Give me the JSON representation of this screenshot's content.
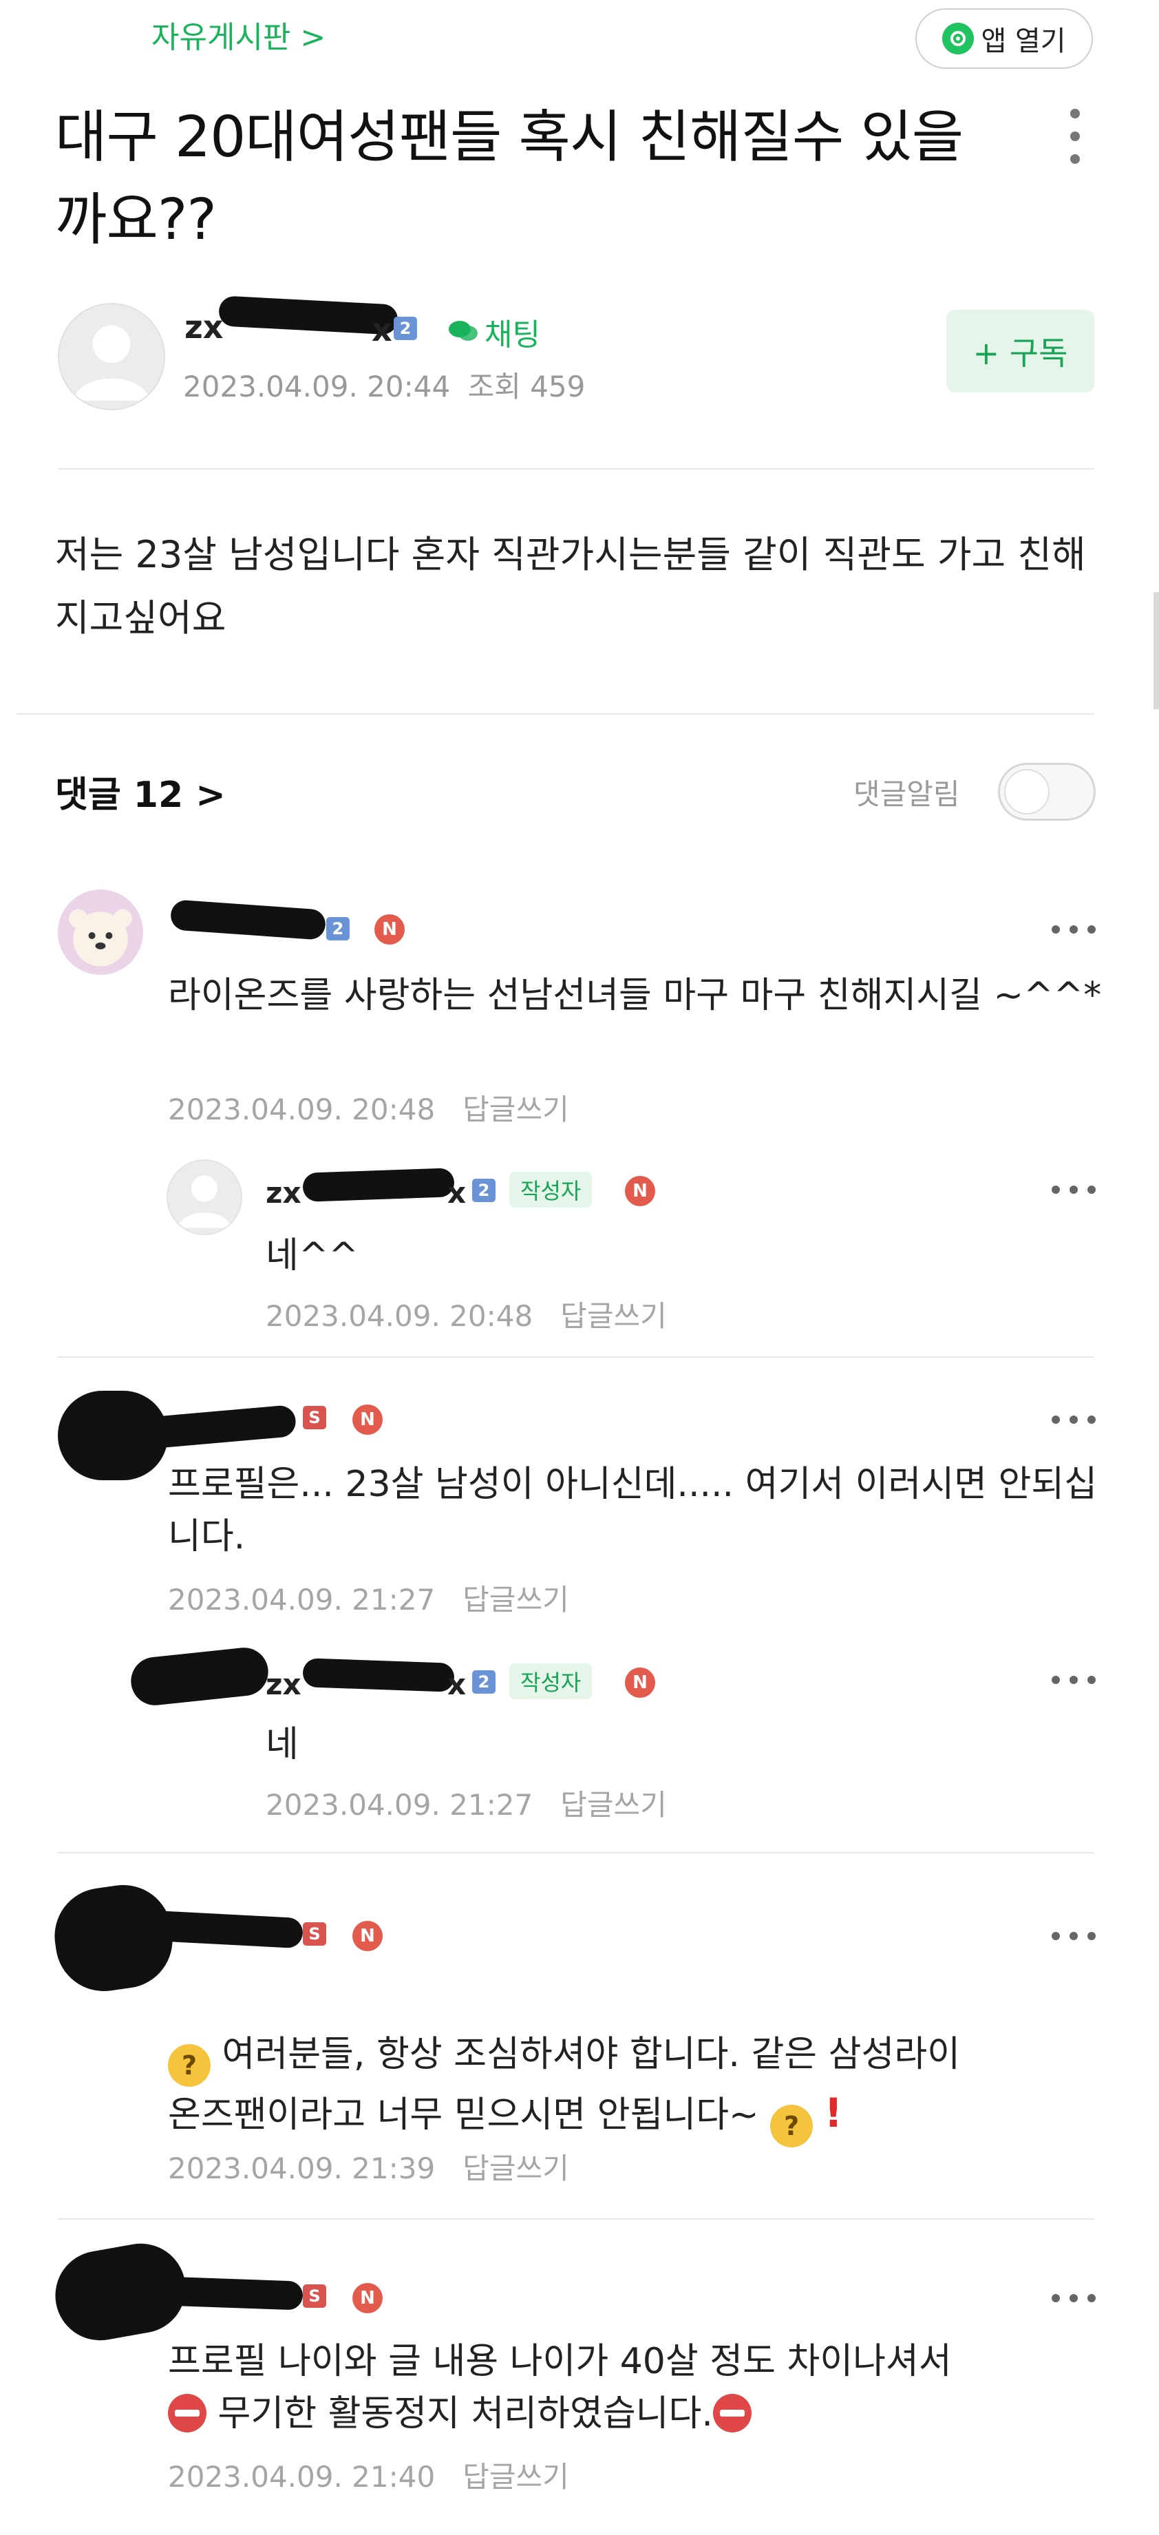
{
  "header": {
    "board_link": "자유게시판 >",
    "app_open_label": "앱 열기"
  },
  "post": {
    "title": "대구 20대여성팬들 혹시 친해질수 있을까요??",
    "author_name": "zx",
    "author_name_tail": "x",
    "author_level": "2",
    "chat_label": "채팅",
    "date": "2023.04.09. 20:44",
    "views": "조회 459",
    "subscribe_label": "+ 구독",
    "body": "저는 23살 남성입니다 혼자 직관가시는분들 같이 직관도 가고 친해 지고싶어요"
  },
  "comments_section": {
    "title": "댓글 12 >",
    "notify_label": "댓글알림"
  },
  "comments": [
    {
      "level": "2",
      "badge": "N",
      "text": "라이온즈를 사랑하는 선남선녀들 마구 마구 친해지시길 ~^^*",
      "date": "2023.04.09. 20:48",
      "reply": "답글쓰기"
    },
    {
      "name": "zx",
      "name_tail": "x",
      "level": "2",
      "author_tag": "작성자",
      "badge": "N",
      "text": "네^^",
      "date": "2023.04.09. 20:48",
      "reply": "답글쓰기"
    },
    {
      "level": "S",
      "badge": "N",
      "text": "프로필은... 23살 남성이 아니신데..... 여기서 이러시면 안되십니다.",
      "date": "2023.04.09. 21:27",
      "reply": "답글쓰기"
    },
    {
      "name": "zx",
      "name_tail": "x",
      "level": "2",
      "author_tag": "작성자",
      "badge": "N",
      "text": "네",
      "date": "2023.04.09. 21:27",
      "reply": "답글쓰기"
    },
    {
      "level": "S",
      "badge": "N",
      "text_line1": "여러분들, 항상 조심하셔야 합니다. 같은 삼성라이",
      "text_line2": "온즈팬이라고 너무 믿으시면 안됩니다~",
      "exclaim": "!",
      "date": "2023.04.09. 21:39",
      "reply": "답글쓰기"
    },
    {
      "level": "S",
      "badge": "N",
      "text_line1": "프로필 나이와 글 내용 나이가 40살 정도 차이나셔서",
      "text_line2": "무기한 활동정지 처리하였습니다.",
      "date": "2023.04.09. 21:40",
      "reply": "답글쓰기"
    }
  ],
  "icons": {
    "app": "naver-cafe-icon",
    "menu": "more-vertical-icon",
    "chat": "chat-bubble-icon",
    "comment_menu": "more-horizontal-icon",
    "thinking": "thinking-face-emoji",
    "no_entry": "no-entry-emoji"
  },
  "colors": {
    "accent_green": "#19b35b",
    "badge_red": "#e25b4d",
    "level_blue": "#6a93d6"
  }
}
